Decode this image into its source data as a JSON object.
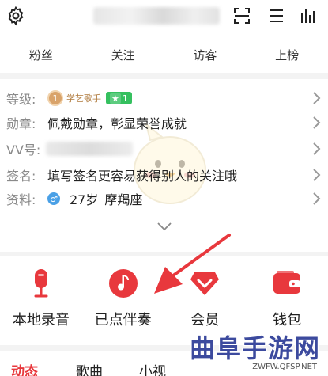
{
  "stats": [
    "粉丝",
    "关注",
    "访客",
    "上榜"
  ],
  "info": {
    "level": {
      "label": "等级:",
      "level_num": "1",
      "title": "学艺歌手",
      "star_count": "1"
    },
    "medal": {
      "label": "勋章:",
      "value": "佩戴勋章，彰显荣誉成就"
    },
    "vv": {
      "label": "VV号:"
    },
    "signature": {
      "label": "签名:",
      "placeholder": "填写签名更容易获得别人的关注哦"
    },
    "profile": {
      "label": "资料:",
      "gender_symbol": "♂",
      "age": "27岁",
      "zodiac": "摩羯座"
    }
  },
  "tiles": [
    {
      "label": "本地录音",
      "icon": "microphone-icon",
      "color": "#e8383d"
    },
    {
      "label": "已点伴奏",
      "icon": "music-note-icon",
      "color": "#e8383d"
    },
    {
      "label": "会员",
      "icon": "vip-diamond-icon",
      "color": "#e8383d"
    },
    {
      "label": "钱包",
      "icon": "wallet-icon",
      "color": "#e8383d"
    }
  ],
  "tabs": [
    {
      "label": "动态",
      "active": true
    },
    {
      "label": "歌曲",
      "active": false
    },
    {
      "label": "小视",
      "active": false
    }
  ],
  "watermark": {
    "title": "曲阜手游网",
    "url": "ZWFW.QFSP.NET"
  },
  "colors": {
    "accent": "#e8383d",
    "muted": "#8a8a8a",
    "green_badge": "#35c05f"
  }
}
